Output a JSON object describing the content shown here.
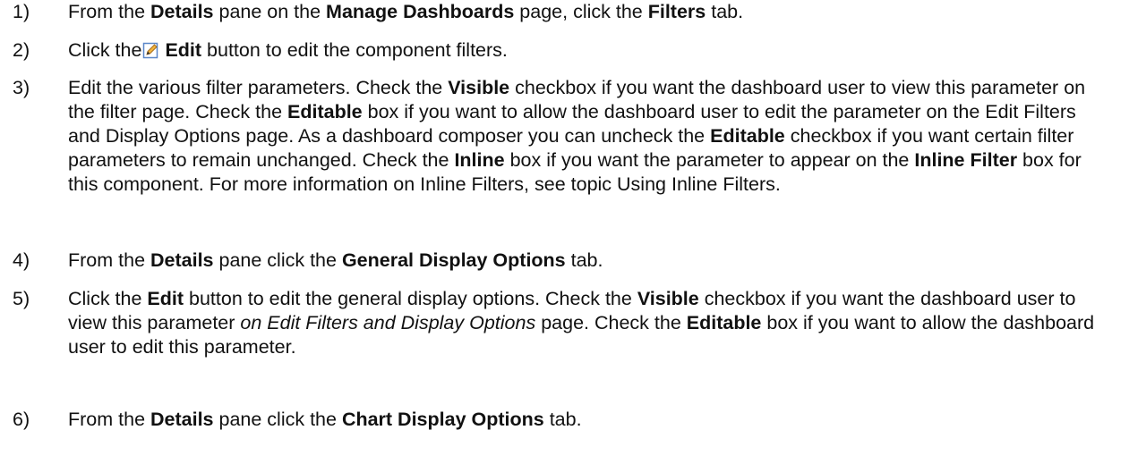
{
  "steps": [
    {
      "num": "1)",
      "parts": [
        {
          "t": "From the "
        },
        {
          "t": "Details",
          "b": true
        },
        {
          "t": " pane on the "
        },
        {
          "t": "Manage Dashboards",
          "b": true
        },
        {
          "t": " page, click the "
        },
        {
          "t": "Filters",
          "b": true
        },
        {
          "t": " tab."
        }
      ]
    },
    {
      "num": "2)",
      "parts": [
        {
          "t": "Click the"
        },
        {
          "icon": "edit-icon"
        },
        {
          "t": "Edit",
          "b": true
        },
        {
          "t": " button to edit the component filters."
        }
      ]
    },
    {
      "num": "3)",
      "parts": [
        {
          "t": "Edit the various filter parameters. Check the "
        },
        {
          "t": "Visible",
          "b": true
        },
        {
          "t": " checkbox if you want the dashboard user to view this parameter on the filter page. Check the "
        },
        {
          "t": "Editable",
          "b": true
        },
        {
          "t": " box if you want to allow the dashboard user to edit the parameter on the Edit Filters and Display Options page. As a dashboard composer you can uncheck the "
        },
        {
          "t": "Editable",
          "b": true
        },
        {
          "t": " checkbox if you want certain filter parameters to remain unchanged. Check the "
        },
        {
          "t": "Inline",
          "b": true
        },
        {
          "t": " box if you want the parameter to appear on the "
        },
        {
          "t": "Inline Filter",
          "b": true
        },
        {
          "t": " box for this component. For more information on Inline Filters, see topic Using Inline Filters."
        }
      ]
    },
    {
      "num": "4)",
      "parts": [
        {
          "t": "From the "
        },
        {
          "t": "Details",
          "b": true
        },
        {
          "t": " pane click the "
        },
        {
          "t": "General Display Options",
          "b": true
        },
        {
          "t": " tab."
        }
      ]
    },
    {
      "num": "5)",
      "parts": [
        {
          "t": "Click the "
        },
        {
          "t": "Edit",
          "b": true
        },
        {
          "t": " button to edit the general display options. Check the "
        },
        {
          "t": "Visible",
          "b": true
        },
        {
          "t": " checkbox if you want the dashboard user to view this parameter "
        },
        {
          "t": "on Edit Filters and Display Options",
          "i": true
        },
        {
          "t": " page. Check the "
        },
        {
          "t": "Editable",
          "b": true
        },
        {
          "t": " box if you want to allow the dashboard user to edit this parameter."
        }
      ]
    },
    {
      "num": "6)",
      "parts": [
        {
          "t": "From the "
        },
        {
          "t": "Details",
          "b": true
        },
        {
          "t": " pane click the "
        },
        {
          "t": "Chart Display Options",
          "b": true
        },
        {
          "t": " tab."
        }
      ]
    }
  ]
}
